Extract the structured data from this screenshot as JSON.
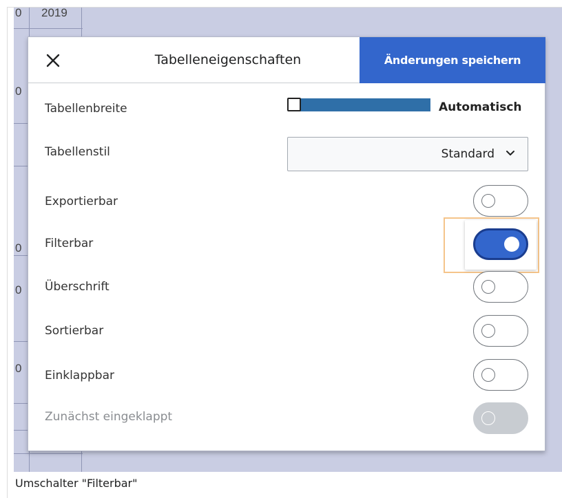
{
  "background_table": {
    "cells": [
      "0",
      "2019",
      "0",
      "0",
      "0",
      "0"
    ]
  },
  "dialog": {
    "title": "Tabelleneigenschaften",
    "close_icon": "close-icon",
    "save_label": "Änderungen speichern",
    "accent_color": "#3366cc"
  },
  "properties": {
    "table_width": {
      "label": "Tabellenbreite",
      "value_label": "Automatisch"
    },
    "table_style": {
      "label": "Tabellenstil",
      "selected": "Standard",
      "chevron_icon": "chevron-down-icon"
    },
    "toggles": [
      {
        "label": "Exportierbar",
        "on": false,
        "disabled": false
      },
      {
        "label": "Filterbar",
        "on": true,
        "disabled": false
      },
      {
        "label": "Überschrift",
        "on": false,
        "disabled": false
      },
      {
        "label": "Sortierbar",
        "on": false,
        "disabled": false
      },
      {
        "label": "Einklappbar",
        "on": false,
        "disabled": false
      },
      {
        "label": "Zunächst eingeklappt",
        "on": false,
        "disabled": true
      }
    ]
  },
  "caption": "Umschalter \"Filterbar\""
}
